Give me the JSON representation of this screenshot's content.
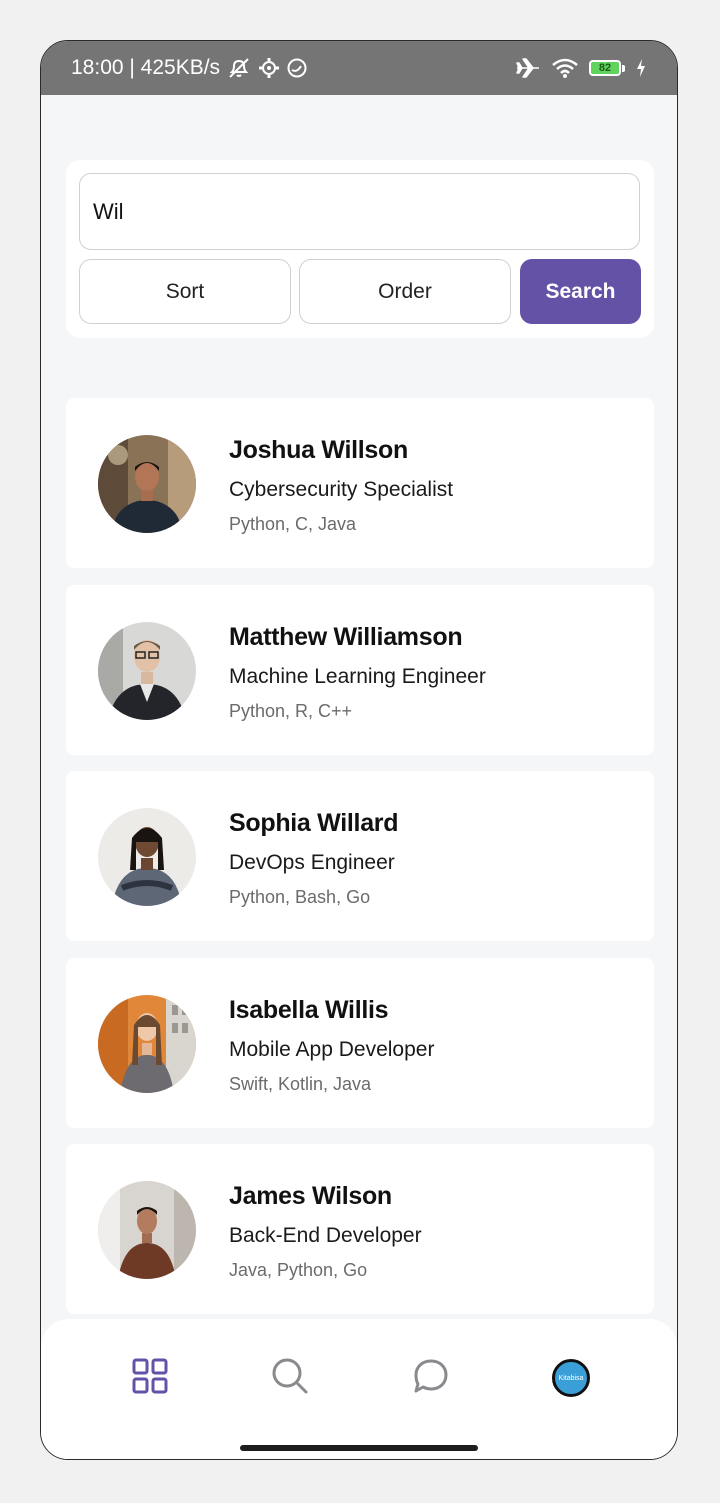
{
  "status_bar": {
    "time_speed": "18:00 | 425KB/s",
    "battery_level": "82"
  },
  "search": {
    "value": "Wil",
    "sort_label": "Sort",
    "order_label": "Order",
    "search_label": "Search",
    "accent_color": "#6452a7"
  },
  "profiles": [
    {
      "name": "Joshua Willson",
      "role": "Cybersecurity Specialist",
      "skills": "Python, C, Java"
    },
    {
      "name": "Matthew Williamson",
      "role": "Machine Learning Engineer",
      "skills": "Python, R, C++"
    },
    {
      "name": "Sophia Willard",
      "role": "DevOps Engineer",
      "skills": "Python, Bash, Go"
    },
    {
      "name": "Isabella Willis",
      "role": "Mobile App Developer",
      "skills": "Swift, Kotlin, Java"
    },
    {
      "name": "James Wilson",
      "role": "Back-End Developer",
      "skills": "Java, Python, Go"
    }
  ],
  "bottom_nav": {
    "items": [
      "grid-icon",
      "search-icon",
      "chat-icon",
      "profile-avatar"
    ],
    "profile_avatar_text": "Kitabisa"
  }
}
